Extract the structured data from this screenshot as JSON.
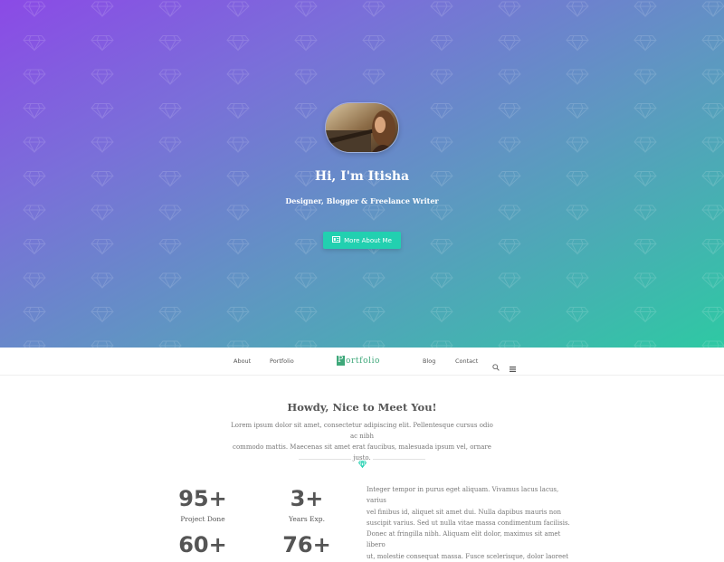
{
  "hero": {
    "title": "Hi, I'm Itisha",
    "subtitle": "Designer, Blogger & Freelance Writer",
    "button_label": "More About Me",
    "gradient": [
      "#8b4ae6",
      "#5f96c2",
      "#2ec9a3"
    ],
    "button_color": "#22d0b0",
    "pattern_icon": "diamond-icon",
    "button_icon": "id-card-icon"
  },
  "nav": {
    "items_left": [
      "About",
      "Portfolio"
    ],
    "logo_initial": "P",
    "logo_rest": "ortfolio",
    "items_right": [
      "Blog",
      "Contact"
    ],
    "icons": [
      "search-icon",
      "menu-icon"
    ],
    "logo_color": "#3ea87a"
  },
  "intro": {
    "title": "Howdy, Nice to Meet You!",
    "text_line1": "Lorem ipsum dolor sit amet, consectetur adipiscing elit. Pellentesque cursus odio ac nibh",
    "text_line2": "commodo mattis. Maecenas sit amet erat faucibus, malesuada ipsum vel, ornare justo.",
    "divider_icon": "diamond-icon",
    "accent": "#22d0b0"
  },
  "stats": [
    {
      "value": "95+",
      "label": "Project Done"
    },
    {
      "value": "3+",
      "label": "Years Exp."
    },
    {
      "value": "60+",
      "label": ""
    },
    {
      "value": "76+",
      "label": ""
    }
  ],
  "stats_text": {
    "line1": "Integer tempor in purus eget aliquam. Vivamus lacus lacus, varius",
    "line2": "vel finibus id, aliquet sit amet dui. Nulla dapibus mauris non",
    "line3": "suscipit varius. Sed ut nulla vitae massa condimentum facilisis.",
    "line4": "Donec at fringilla nibh. Aliquam elit dolor, maximus sit amet libero",
    "line5": "ut, molestie consequat massa. Fusce scelerisque, dolor laoreet"
  }
}
